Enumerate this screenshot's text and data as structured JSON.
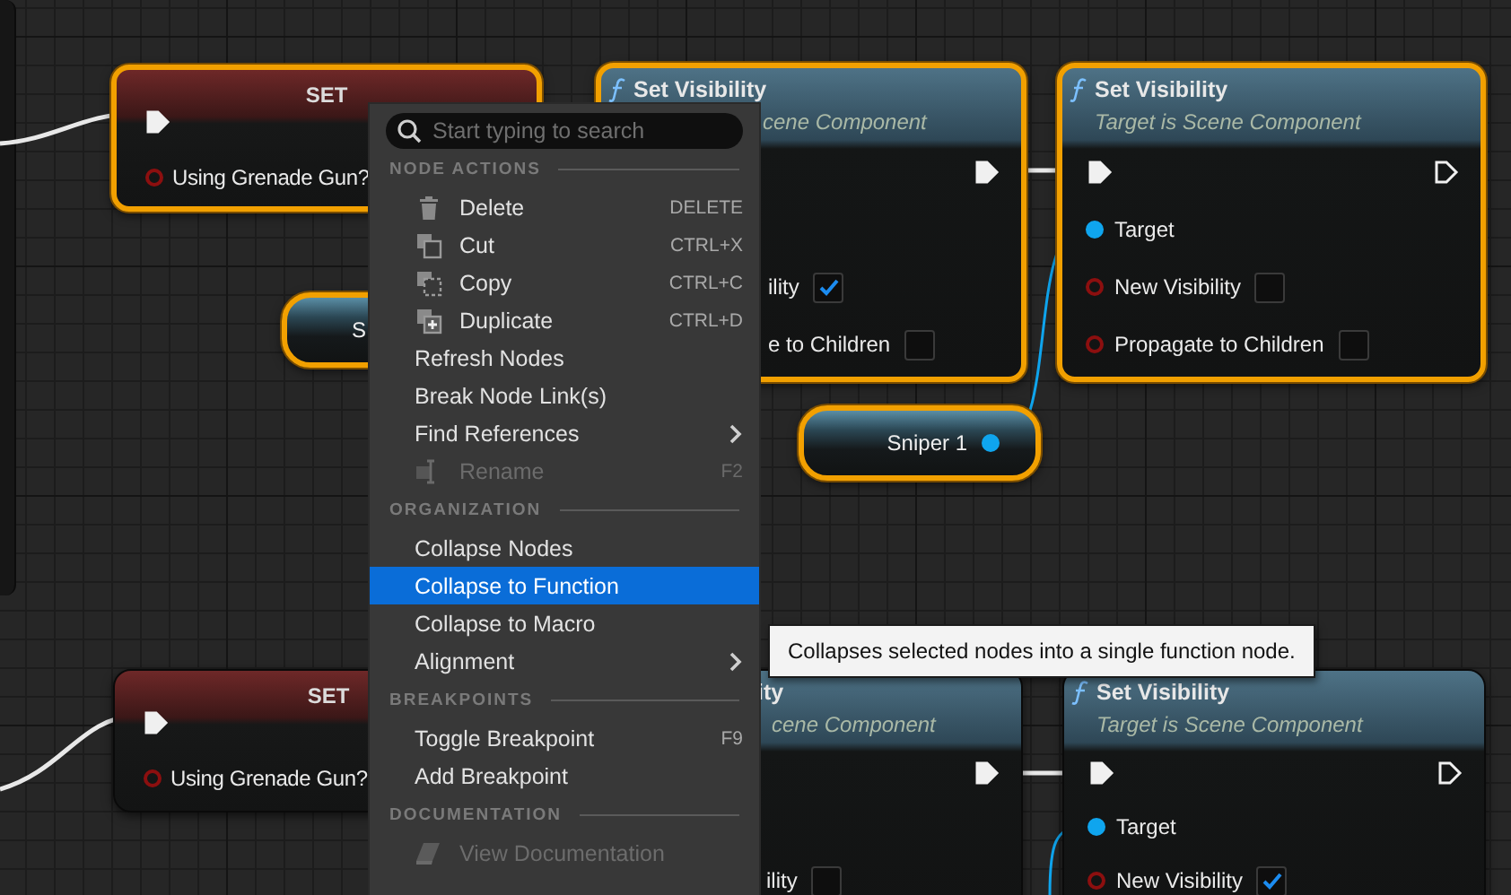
{
  "graph": {
    "nodes": [
      {
        "kind": "set",
        "selected": true,
        "title": "SET",
        "exec_in": {
          "connected": true
        },
        "pins": [
          {
            "kind": "bool",
            "label": "Using Grenade Gun?",
            "connected": false
          }
        ]
      },
      {
        "kind": "variable",
        "selected": true,
        "label": "S"
      },
      {
        "kind": "function",
        "selected": true,
        "title": "Set Visibility",
        "subtitle": "cene Component",
        "exec_out": {
          "connected": true
        },
        "pins": [
          {
            "label": "ility",
            "checked": true
          },
          {
            "label": "e to Children",
            "checked": false
          }
        ]
      },
      {
        "kind": "function",
        "selected": true,
        "title": "Set Visibility",
        "subtitle": "Target is Scene Component",
        "exec_in": {
          "connected": true
        },
        "exec_out": {
          "connected": false
        },
        "pins": [
          {
            "kind": "object",
            "label": "Target",
            "connected": true
          },
          {
            "kind": "bool",
            "label": "New Visibility",
            "connected": false,
            "checked": false
          },
          {
            "kind": "bool",
            "label": "Propagate to Children",
            "connected": false,
            "checked": false
          }
        ]
      },
      {
        "kind": "variable",
        "selected": true,
        "label": "Sniper 1",
        "pin": {
          "kind": "object",
          "connected": true
        }
      },
      {
        "kind": "set",
        "selected": false,
        "title": "SET",
        "exec_in": {
          "connected": true
        },
        "pins": [
          {
            "kind": "bool",
            "label": "Using Grenade Gun?",
            "connected": false
          }
        ]
      },
      {
        "kind": "function",
        "selected": false,
        "title": "ity",
        "subtitle": "cene Component",
        "exec_out": {
          "connected": true
        },
        "pins": [
          {
            "label": "ility",
            "checked": false
          }
        ]
      },
      {
        "kind": "function",
        "selected": false,
        "title": "Set Visibility",
        "subtitle": "Target is Scene Component",
        "exec_in": {
          "connected": true
        },
        "exec_out": {
          "connected": false
        },
        "pins": [
          {
            "kind": "object",
            "label": "Target",
            "connected": true
          },
          {
            "kind": "bool",
            "label": "New Visibility",
            "connected": false,
            "checked": true
          }
        ]
      }
    ]
  },
  "context_menu": {
    "search": {
      "placeholder": "Start typing to search"
    },
    "sections": [
      {
        "heading": "NODE ACTIONS",
        "items": [
          {
            "label": "Delete",
            "shortcut": "DELETE",
            "disabled": false,
            "selected": false,
            "submenu": false
          },
          {
            "label": "Cut",
            "shortcut": "CTRL+X",
            "disabled": false,
            "selected": false,
            "submenu": false
          },
          {
            "label": "Copy",
            "shortcut": "CTRL+C",
            "disabled": false,
            "selected": false,
            "submenu": false
          },
          {
            "label": "Duplicate",
            "shortcut": "CTRL+D",
            "disabled": false,
            "selected": false,
            "submenu": false
          },
          {
            "label": "Refresh Nodes",
            "disabled": false,
            "selected": false,
            "submenu": false
          },
          {
            "label": "Break Node Link(s)",
            "disabled": false,
            "selected": false,
            "submenu": false
          },
          {
            "label": "Find References",
            "disabled": false,
            "selected": false,
            "submenu": true
          },
          {
            "label": "Rename",
            "shortcut": "F2",
            "disabled": true,
            "selected": false,
            "submenu": false
          }
        ]
      },
      {
        "heading": "ORGANIZATION",
        "items": [
          {
            "label": "Collapse Nodes",
            "disabled": false,
            "selected": false,
            "submenu": false
          },
          {
            "label": "Collapse to Function",
            "disabled": false,
            "selected": true,
            "submenu": false
          },
          {
            "label": "Collapse to Macro",
            "disabled": false,
            "selected": false,
            "submenu": false
          },
          {
            "label": "Alignment",
            "disabled": false,
            "selected": false,
            "submenu": true
          }
        ]
      },
      {
        "heading": "BREAKPOINTS",
        "items": [
          {
            "label": "Toggle Breakpoint",
            "shortcut": "F9",
            "disabled": false,
            "selected": false,
            "submenu": false
          },
          {
            "label": "Add Breakpoint",
            "disabled": false,
            "selected": false,
            "submenu": false
          }
        ]
      },
      {
        "heading": "DOCUMENTATION",
        "items": [
          {
            "label": "View Documentation",
            "disabled": true,
            "selected": false,
            "submenu": false
          }
        ]
      }
    ]
  },
  "tooltip": {
    "text": "Collapses selected nodes into a single function node."
  }
}
